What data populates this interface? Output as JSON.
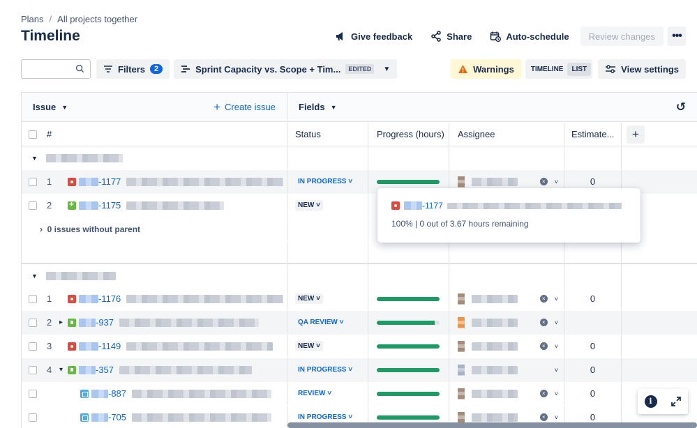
{
  "breadcrumb": {
    "items": [
      "Plans",
      "All projects together"
    ],
    "separator": "/"
  },
  "page": {
    "title": "Timeline"
  },
  "actions": {
    "feedback": "Give feedback",
    "share": "Share",
    "autoschedule": "Auto-schedule",
    "review": "Review changes",
    "more": "•••"
  },
  "toolbar": {
    "search_placeholder": "",
    "filters_label": "Filters",
    "filters_count": "2",
    "view_label": "Sprint Capacity vs. Scope + Tim...",
    "edited": "EDITED",
    "warnings": "Warnings",
    "seg_timeline": "TIMELINE",
    "seg_list": "LIST",
    "view_settings": "View settings"
  },
  "grid": {
    "issue_header": "Issue",
    "create_issue": "Create issue",
    "fields_header": "Fields",
    "cols": {
      "num": "#",
      "status": "Status",
      "progress": "Progress (hours)",
      "assignee": "Assignee",
      "estimate": "Estimate..."
    },
    "no_parent": "0 issues without parent"
  },
  "rows": [
    {
      "num": "1",
      "key": "-1177",
      "type": "bug",
      "status": "IN PROGRESS",
      "status_style": "blue",
      "est": "0"
    },
    {
      "num": "2",
      "key": "-1175",
      "type": "plus",
      "status": "NEW",
      "status_style": "gray",
      "est": ""
    },
    {
      "num": "1",
      "key": "-1176",
      "type": "bug",
      "status": "NEW",
      "status_style": "gray",
      "est": "0"
    },
    {
      "num": "2",
      "key": "-937",
      "type": "story",
      "status": "QA REVIEW",
      "status_style": "blue",
      "est": ""
    },
    {
      "num": "3",
      "key": "-1149",
      "type": "bug",
      "status": "NEW",
      "status_style": "gray",
      "est": "0"
    },
    {
      "num": "4",
      "key": "-357",
      "type": "story",
      "status": "IN PROGRESS",
      "status_style": "blue",
      "est": "0"
    },
    {
      "num": "",
      "key": "-887",
      "type": "task",
      "status": "REVIEW",
      "status_style": "blue",
      "est": "0"
    },
    {
      "num": "",
      "key": "-705",
      "type": "task",
      "status": "IN PROGRESS",
      "status_style": "blue",
      "est": "0"
    }
  ],
  "tooltip": {
    "key": "-1177",
    "summary": "100% | 0 out of 3.67 hours remaining"
  },
  "colors": {
    "accent": "#0c66e4",
    "progress": "#1f9a65",
    "warn_bg": "#fff7d6"
  }
}
